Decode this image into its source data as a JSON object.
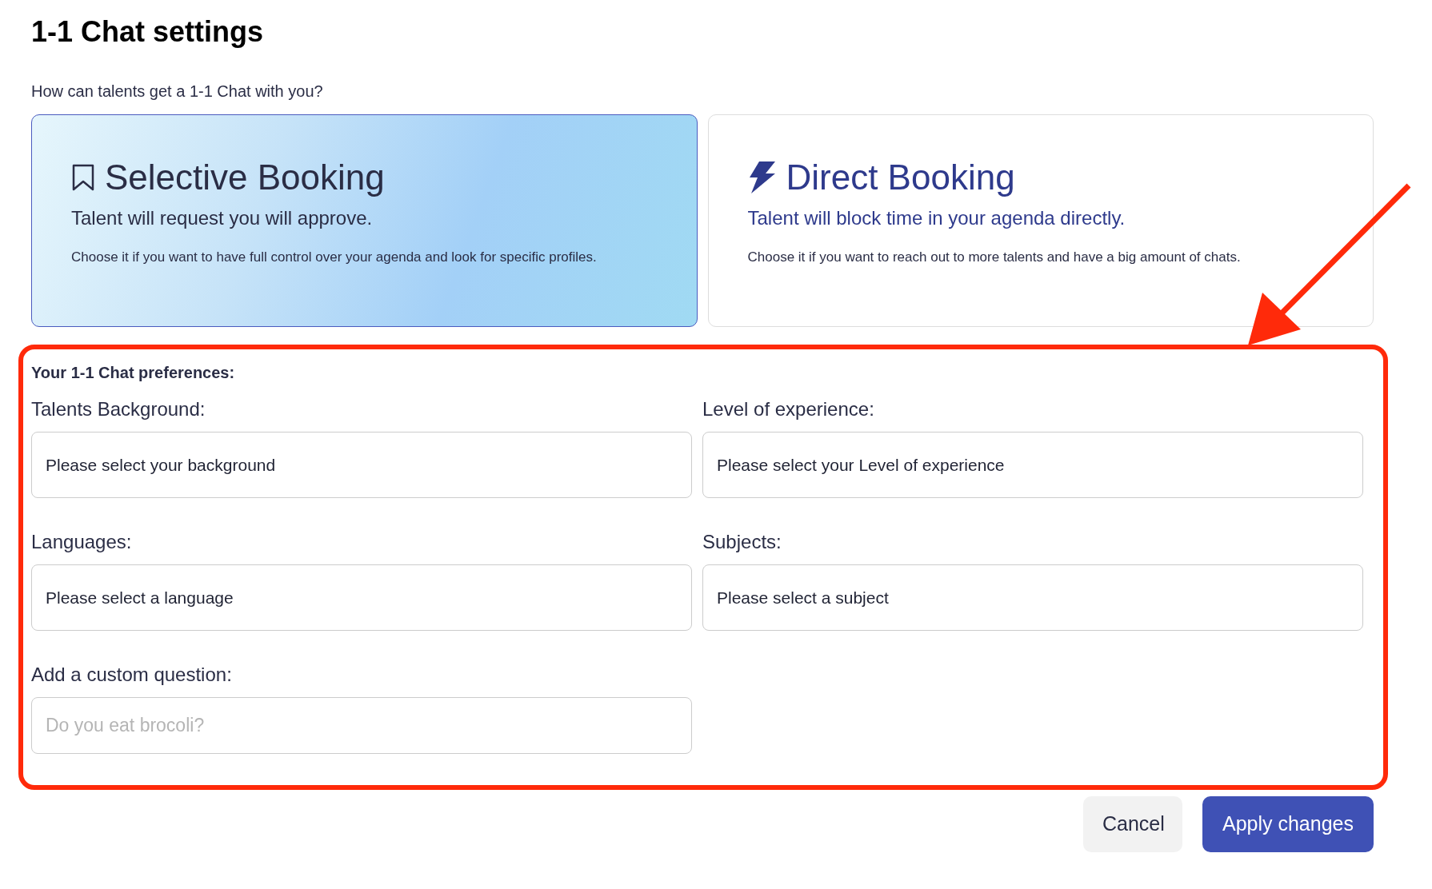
{
  "title": "1-1 Chat settings",
  "question": "How can talents get a 1-1 Chat with you?",
  "booking_options": [
    {
      "kind": "bookmark",
      "title": "Selective Booking",
      "subtitle": "Talent will request you will approve.",
      "description": "Choose it if you want to have full control over your agenda and look for specific profiles.",
      "selected": true
    },
    {
      "kind": "bolt",
      "title": "Direct Booking",
      "subtitle": "Talent will block time in your agenda directly.",
      "description": "Choose it if you want to reach out to more talents and have a big amount of chats.",
      "selected": false
    }
  ],
  "preferences": {
    "heading": "Your 1-1 Chat preferences:",
    "fields": [
      {
        "kind": "select",
        "label": "Talents Background:",
        "placeholder": "Please select your background"
      },
      {
        "kind": "select",
        "label": "Level of experience:",
        "placeholder": "Please select your Level of experience"
      },
      {
        "kind": "select",
        "label": "Languages:",
        "placeholder": "Please select a language"
      },
      {
        "kind": "select",
        "label": "Subjects:",
        "placeholder": "Please select a subject"
      },
      {
        "kind": "text",
        "label": "Add a custom question:",
        "placeholder": "Do you eat brocoli?"
      }
    ]
  },
  "buttons": [
    {
      "kind": "secondary",
      "label": "Cancel"
    },
    {
      "kind": "primary",
      "label": "Apply changes"
    }
  ]
}
